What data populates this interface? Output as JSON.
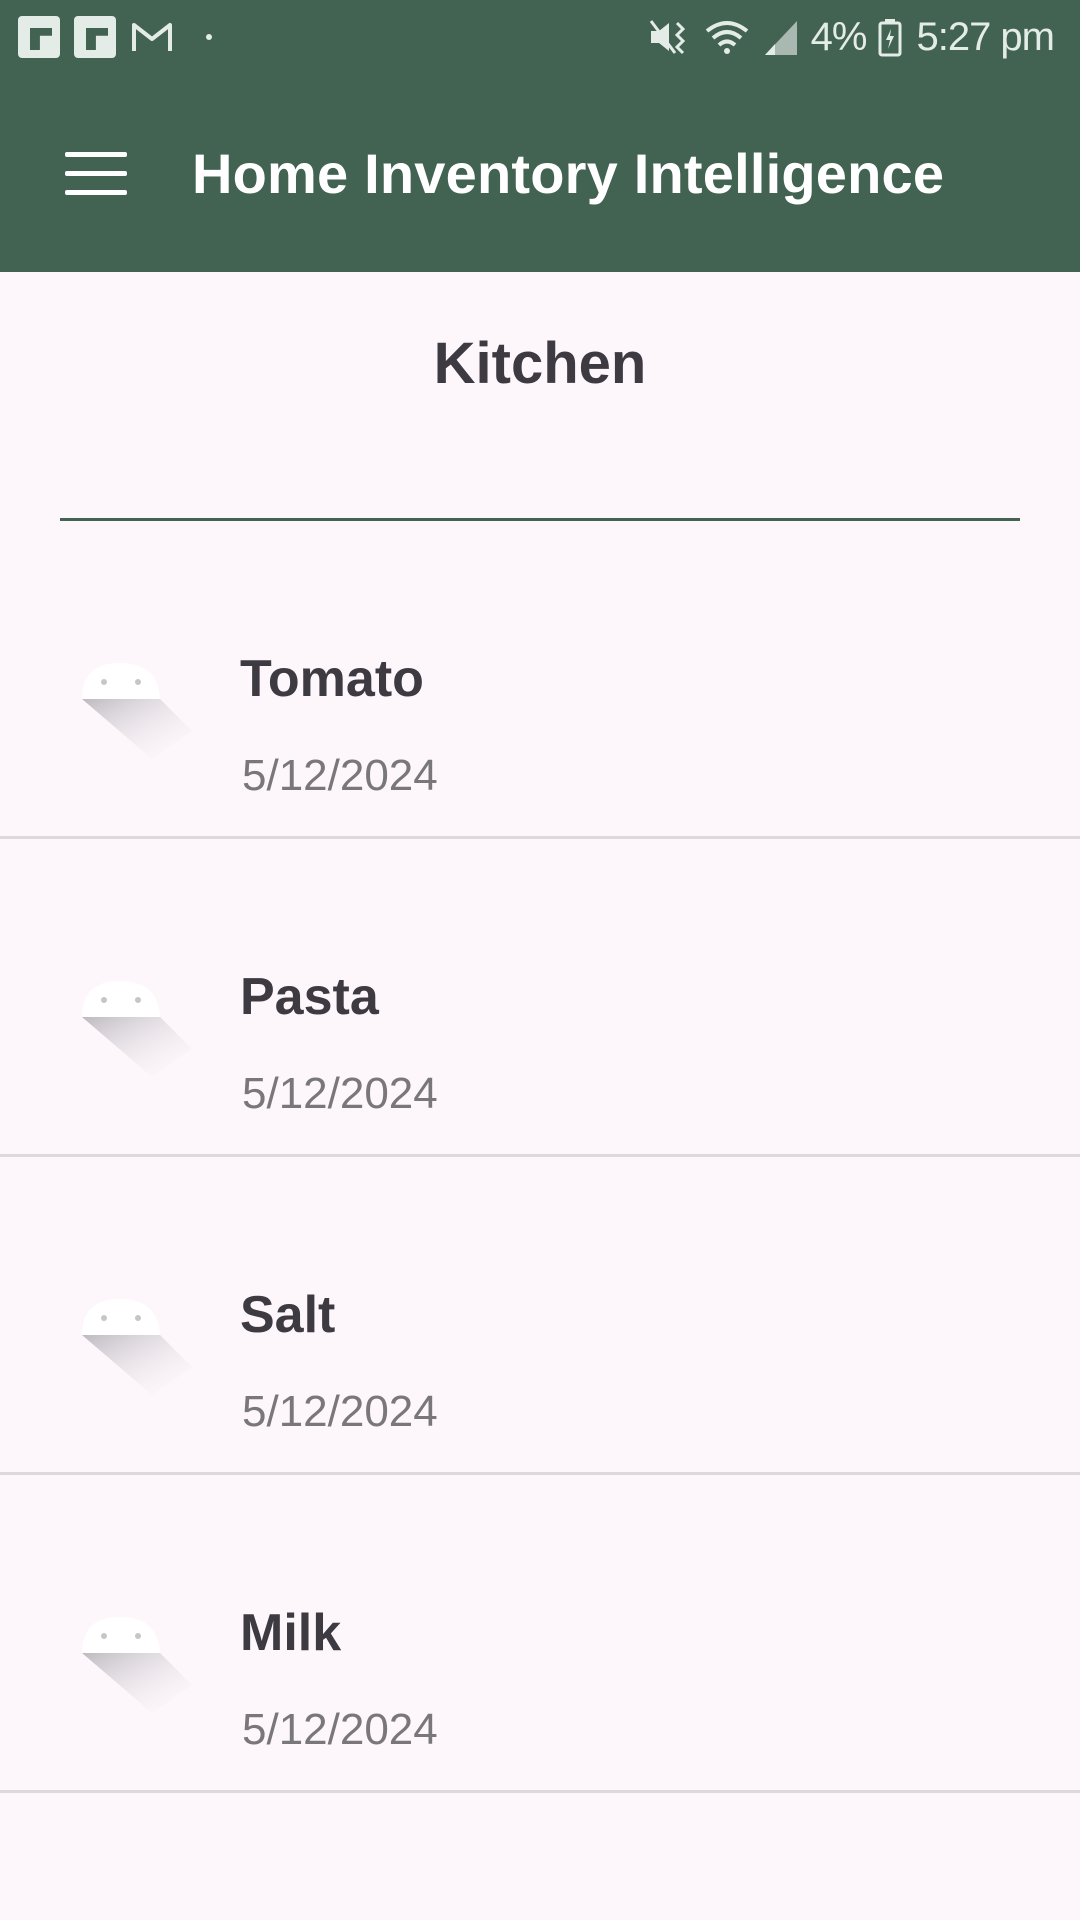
{
  "status_bar": {
    "battery": "4%",
    "time": "5:27 pm"
  },
  "toolbar": {
    "title": "Home Inventory Intelligence",
    "menu_icon": "hamburger-menu-icon"
  },
  "room": {
    "title": "Kitchen"
  },
  "items": [
    {
      "name": "Tomato",
      "date": "5/12/2024",
      "icon": "android-placeholder-icon"
    },
    {
      "name": "Pasta",
      "date": "5/12/2024",
      "icon": "android-placeholder-icon"
    },
    {
      "name": "Salt",
      "date": "5/12/2024",
      "icon": "android-placeholder-icon"
    },
    {
      "name": "Milk",
      "date": "5/12/2024",
      "icon": "android-placeholder-icon"
    }
  ],
  "colors": {
    "app_bar": "#426252",
    "background": "#FDF7FC",
    "primary_text": "#3E3A41",
    "secondary_text": "#7A777B",
    "divider": "#DCD8DC"
  }
}
